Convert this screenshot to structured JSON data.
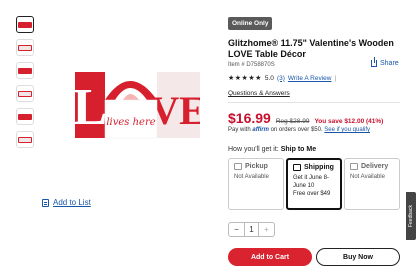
{
  "badge": "Online Only",
  "title": "Glitzhome® 11.75\" Valentine's Wooden LOVE Table Décor",
  "item_number": "Item # D758870S",
  "share_label": "Share",
  "rating": {
    "stars": "★★★★★",
    "value": "5.0",
    "count": "(3)",
    "write_review": "Write A Review",
    "separator": "|"
  },
  "qa_label": "Questions & Answers",
  "price": {
    "current": "$16.99",
    "regular": "Reg $28.99",
    "savings": "You save $12.00 (41%)"
  },
  "affirm": {
    "prefix": "Pay with",
    "brand": "affirm",
    "suffix": "on orders over $50.",
    "link": "See if you qualify"
  },
  "fulfillment": {
    "prompt": "How you'll get it:",
    "selected": "Ship to Me",
    "options": [
      {
        "label": "Pickup",
        "lines": [
          "Not Available"
        ]
      },
      {
        "label": "Shipping",
        "lines": [
          "Get it June 8-",
          "June 10",
          "Free over $49"
        ]
      },
      {
        "label": "Delivery",
        "lines": [
          "Not Available"
        ]
      }
    ]
  },
  "quantity": {
    "minus": "−",
    "value": "1",
    "plus": "+"
  },
  "add_to_cart": "Add to Cart",
  "buy_now": "Buy Now",
  "add_to_list": "Add to List",
  "feedback": "Feedback",
  "product_image": {
    "letters_L": "L",
    "letters_VE": "VE",
    "banner": "lives here"
  },
  "colors": {
    "accent": "#c8102e",
    "cart": "#d9232f",
    "link": "#1a56a8"
  }
}
